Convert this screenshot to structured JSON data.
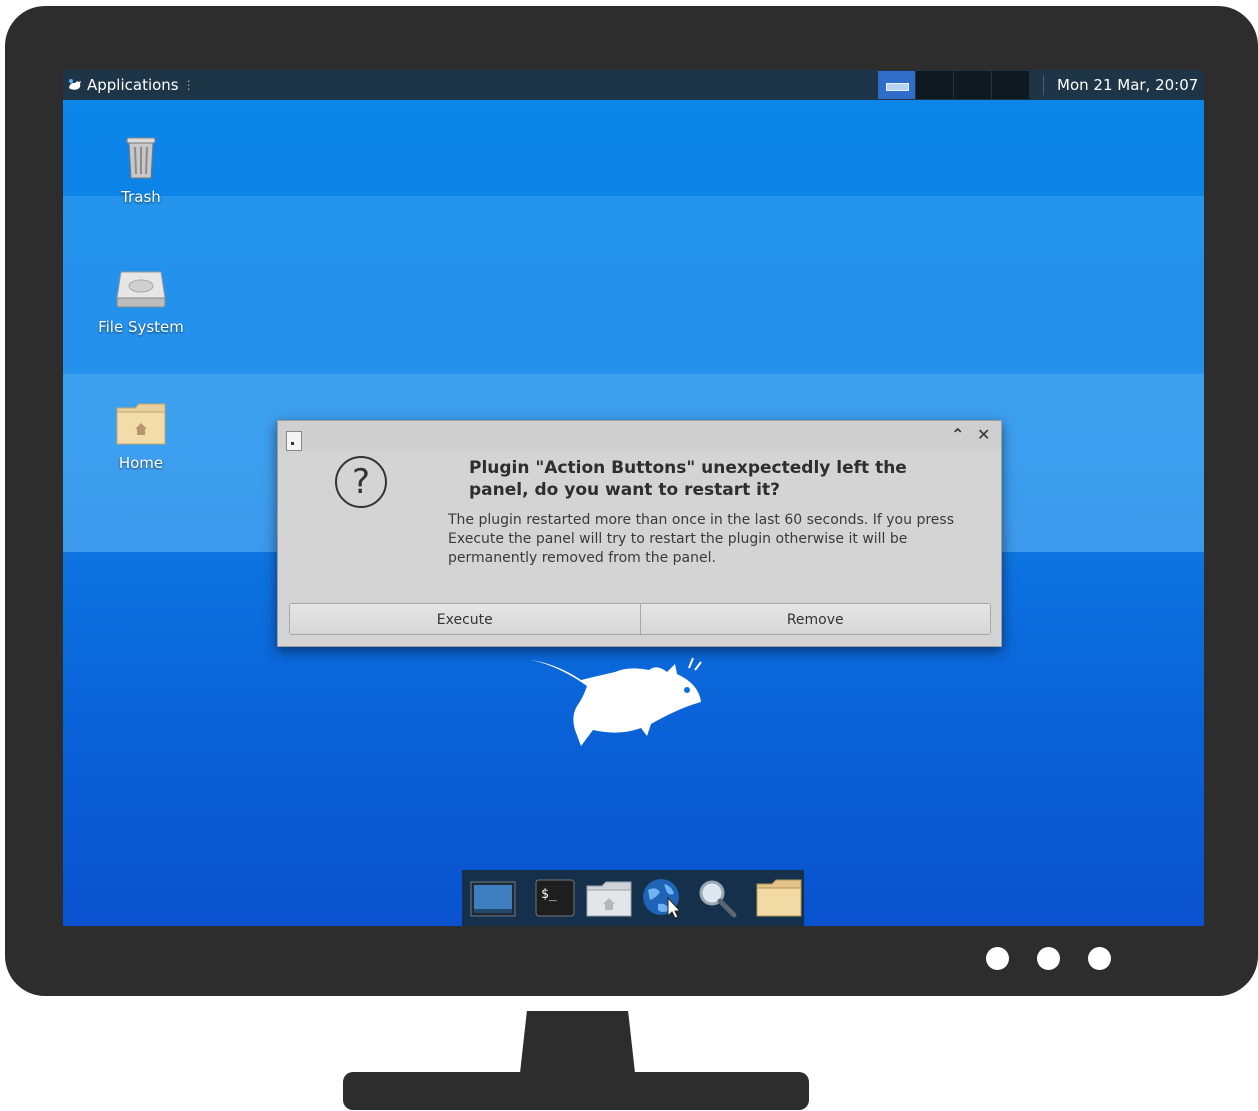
{
  "panel": {
    "applications_label": "Applications",
    "clock": "Mon 21 Mar, 20:07",
    "workspaces": 4
  },
  "desktop": {
    "icons": [
      {
        "label": "Trash",
        "icon": "trash-icon"
      },
      {
        "label": "File System",
        "icon": "drive-icon"
      },
      {
        "label": "Home",
        "icon": "home-folder-icon"
      }
    ]
  },
  "dialog": {
    "primary_text": "Plugin \"Action Buttons\" unexpectedly left the panel, do you want to restart it?",
    "secondary_text": "The plugin restarted more than once in the last 60 seconds. If you press Execute the panel will try to restart the plugin otherwise it will be permanently removed from the panel.",
    "execute_label": "Execute",
    "remove_label": "Remove"
  },
  "dock": {
    "items": [
      "show-desktop-icon",
      "terminal-icon",
      "file-manager-icon",
      "web-browser-icon",
      "search-icon",
      "folder-icon"
    ],
    "terminal_glyph": "$_"
  },
  "colors": {
    "panel_bg": "#1d3547",
    "desktop_blue": "#0b86e8",
    "dialog_bg": "#d4d4d4",
    "monitor_frame": "#2d2d2d"
  }
}
